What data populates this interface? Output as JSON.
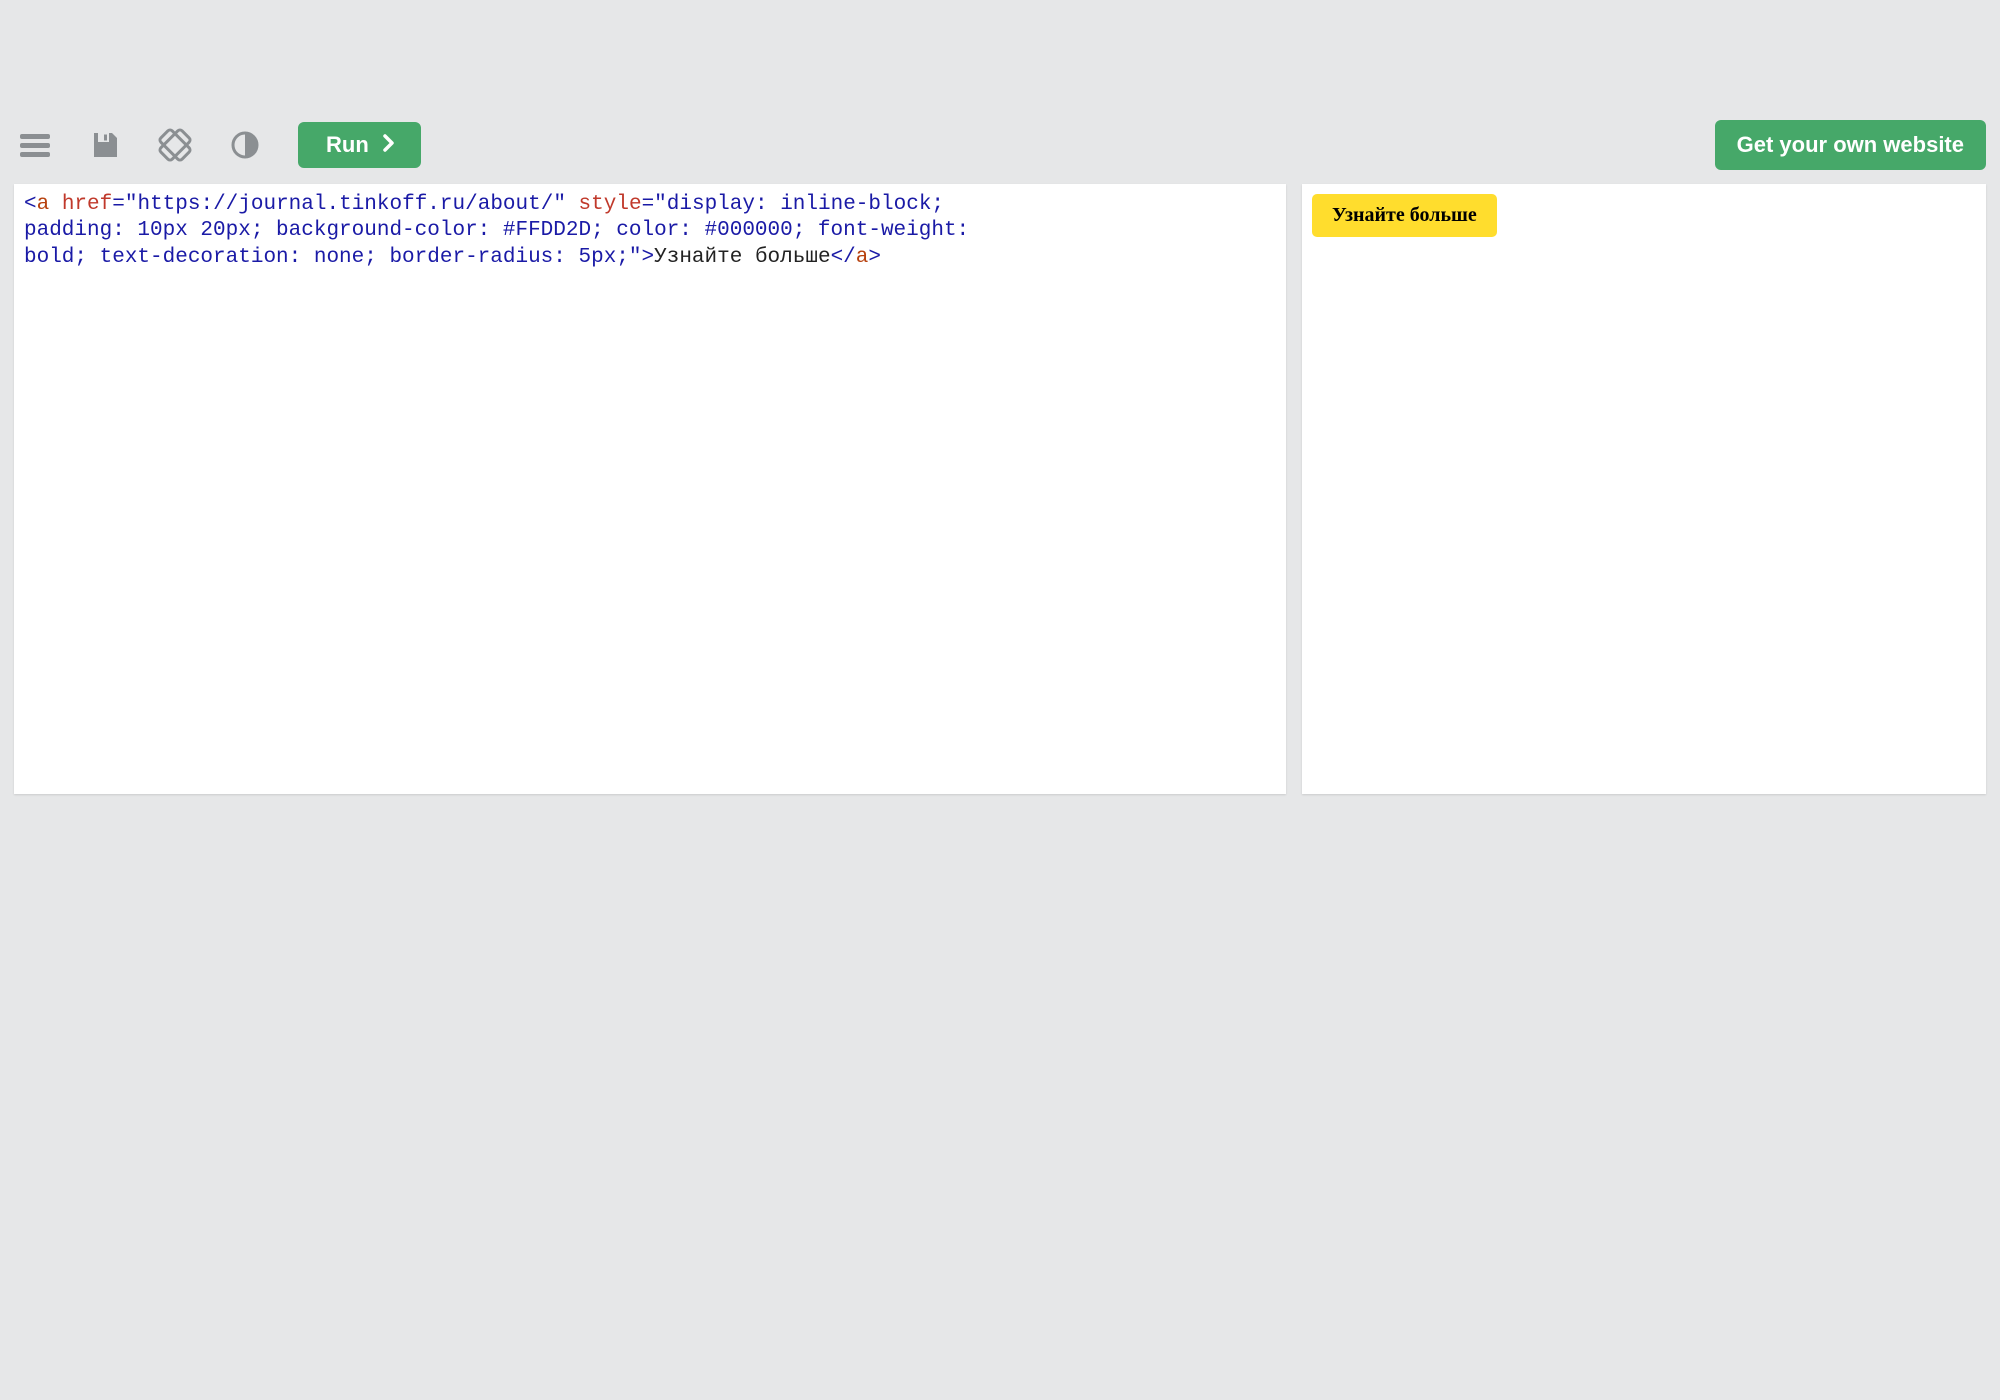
{
  "toolbar": {
    "run_label": "Run",
    "own_site_label": "Get your own website"
  },
  "code": {
    "tag": "a",
    "href_attr": "href",
    "href_val": "\"https://journal.tinkoff.ru/about/\"",
    "style_attr": "style",
    "style_val_1": "\"display: inline-block; ",
    "style_val_2": "padding: 10px 20px; background-color: #FFDD2D; color: #000000; font-weight: ",
    "style_val_3": "bold; text-decoration: none; border-radius: 5px;\"",
    "inner_text": "Узнайте больше"
  },
  "preview": {
    "button_text": "Узнайте больше"
  }
}
